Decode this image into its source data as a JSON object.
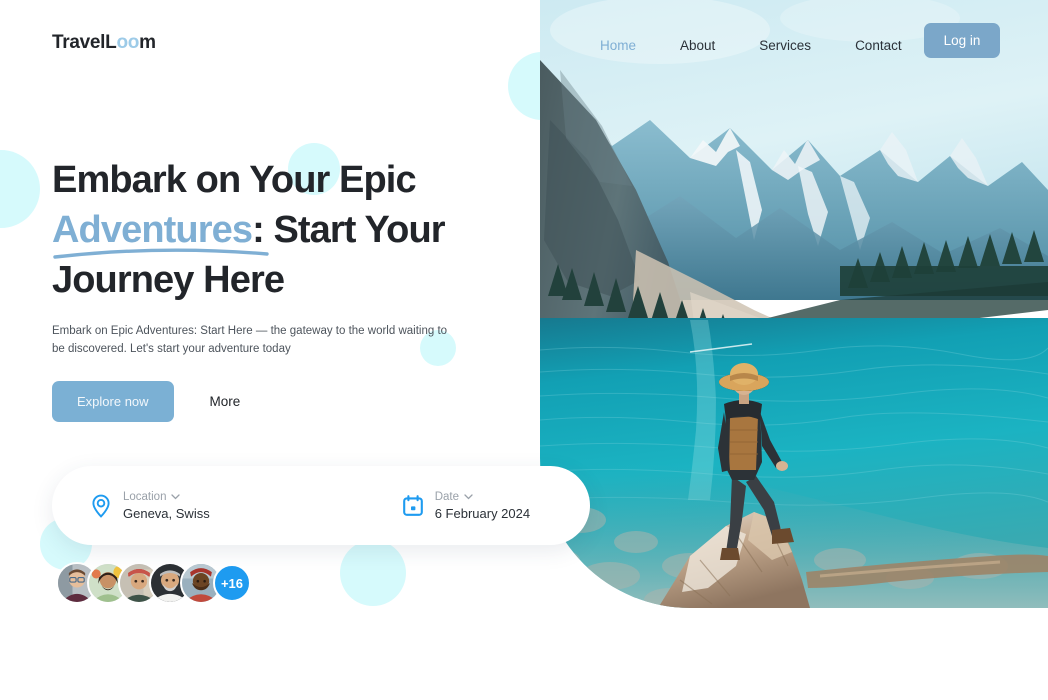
{
  "brand": {
    "name_part1": "Travel",
    "name_accent": "L",
    "name_accent2": "oo",
    "name_part3": "m",
    "full": "TravelLoom",
    "accent_color": "#9DCBE8"
  },
  "nav": {
    "items": [
      {
        "label": "Home",
        "active": true
      },
      {
        "label": "About",
        "active": false
      },
      {
        "label": "Services",
        "active": false
      },
      {
        "label": "Contact",
        "active": false
      }
    ],
    "login_label": "Log in",
    "login_bg": "#7BA7C9",
    "active_color": "#7FAFD4"
  },
  "hero": {
    "headline_line1": "Embark on Your Epic",
    "headline_accent": "Adventures",
    "headline_line2_rest": ": Start Your",
    "headline_line3": "Journey Here",
    "accent_color": "#7FAFD4",
    "subtitle": "Embark on Epic Adventures: Start Here — the gateway to the world waiting to be discovered. Let's start your adventure today",
    "cta_primary": "Explore now",
    "cta_secondary": "More",
    "cta_primary_bg": "#7BB0D4"
  },
  "booking": {
    "location": {
      "label": "Location",
      "value": "Geneva, Swiss",
      "icon": "map-pin-icon",
      "icon_color": "#1E9BF0"
    },
    "date": {
      "label": "Date",
      "value": "6 February 2024",
      "icon": "calendar-icon",
      "icon_color": "#1E9BF0"
    },
    "chevron": "⌄"
  },
  "social_proof": {
    "avatar_count": 5,
    "more_label": "+16",
    "more_bg": "#1E9BF0"
  },
  "decor": {
    "circle_color": "#D6FAFC"
  },
  "photo": {
    "alt": "Traveler in straw hat standing on rock above turquoise mountain lake",
    "sky_color": "#D9F0F6",
    "water_color": "#1B8FA3",
    "mountain_color": "#6FA8BC"
  }
}
